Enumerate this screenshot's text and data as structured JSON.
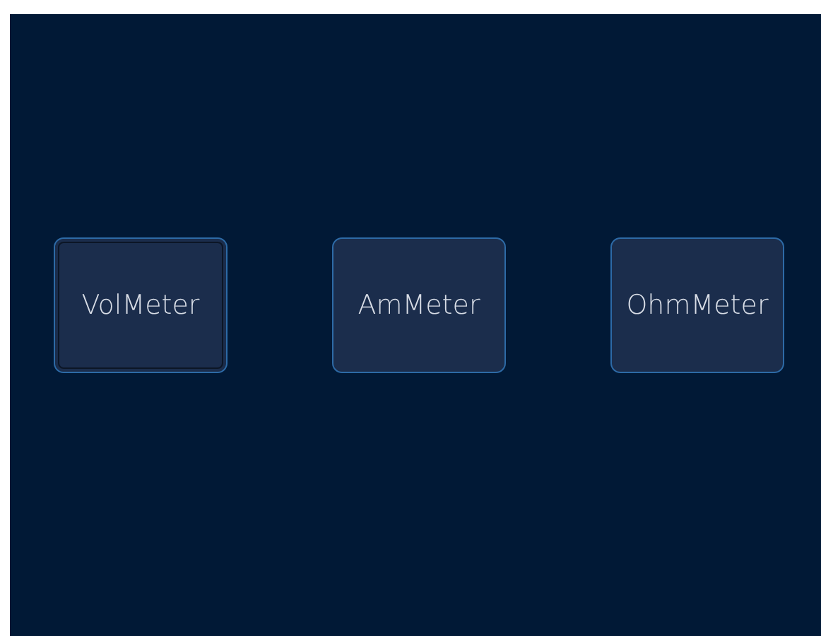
{
  "buttons": [
    {
      "label": "VolMeter",
      "focused": true
    },
    {
      "label": "AmMeter",
      "focused": false
    },
    {
      "label": "OhmMeter",
      "focused": false
    }
  ]
}
